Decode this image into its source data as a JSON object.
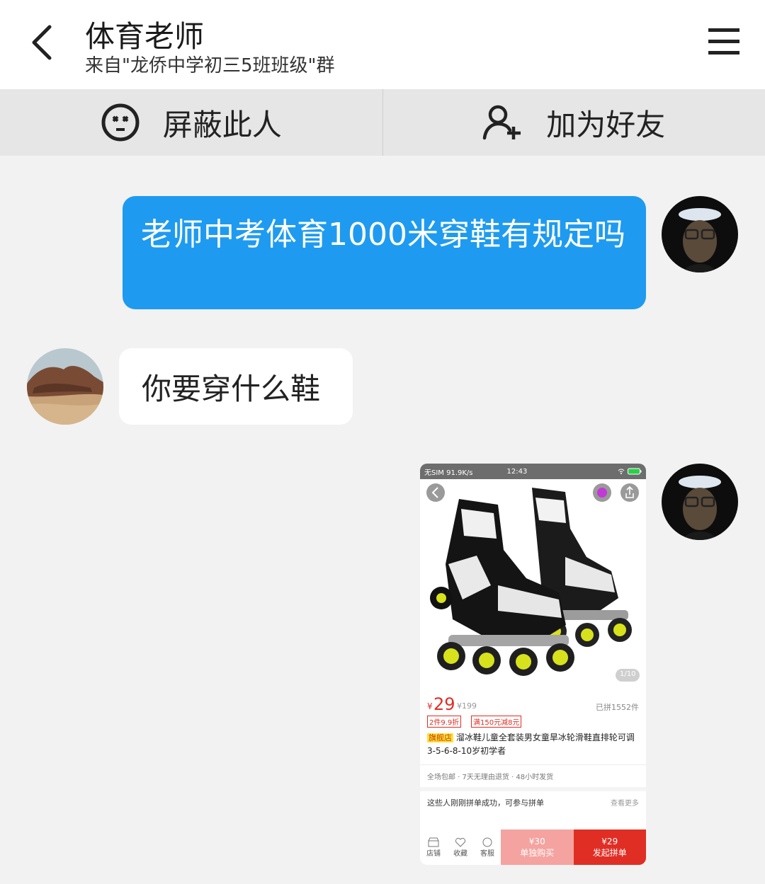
{
  "header": {
    "title": "体育老师",
    "subtitle": "来自\"龙侨中学初三5班班级\"群"
  },
  "actions": {
    "block_label": "屏蔽此人",
    "add_friend_label": "加为好友"
  },
  "messages": {
    "outgoing_text": "老师中考体育1000米穿鞋有规定吗",
    "incoming_text": "你要穿什么鞋"
  },
  "screenshot": {
    "status_left": "无SIM 91.9K/s",
    "status_time": "12:43",
    "image_counter": "1/10",
    "price": "29",
    "price_symbol": "¥",
    "original_price": "¥199",
    "sold": "已拼1552件",
    "promo1": "2件9.9折",
    "promo2": "满150元减8元",
    "store_tag": "旗舰店",
    "product_title": "溜冰鞋儿童全套装男女童旱冰轮滑鞋直排轮可调3-5-6-8-10岁初学者",
    "service": "全场包邮 · 7天无理由退货 · 48小时发货",
    "group_text": "这些人刚刚拼单成功，可参与拼单",
    "see_more": "查看更多",
    "bottom": {
      "shop": "店铺",
      "fav": "收藏",
      "service": "客服",
      "single_price": "¥30",
      "single_label": "单独购买",
      "group_price": "¥29",
      "group_label": "发起拼单"
    }
  },
  "colors": {
    "bubble_blue": "#1e9bf0",
    "price_red": "#e02e24",
    "buy_pink": "#f4a3a0",
    "buy_red": "#e02e24"
  }
}
